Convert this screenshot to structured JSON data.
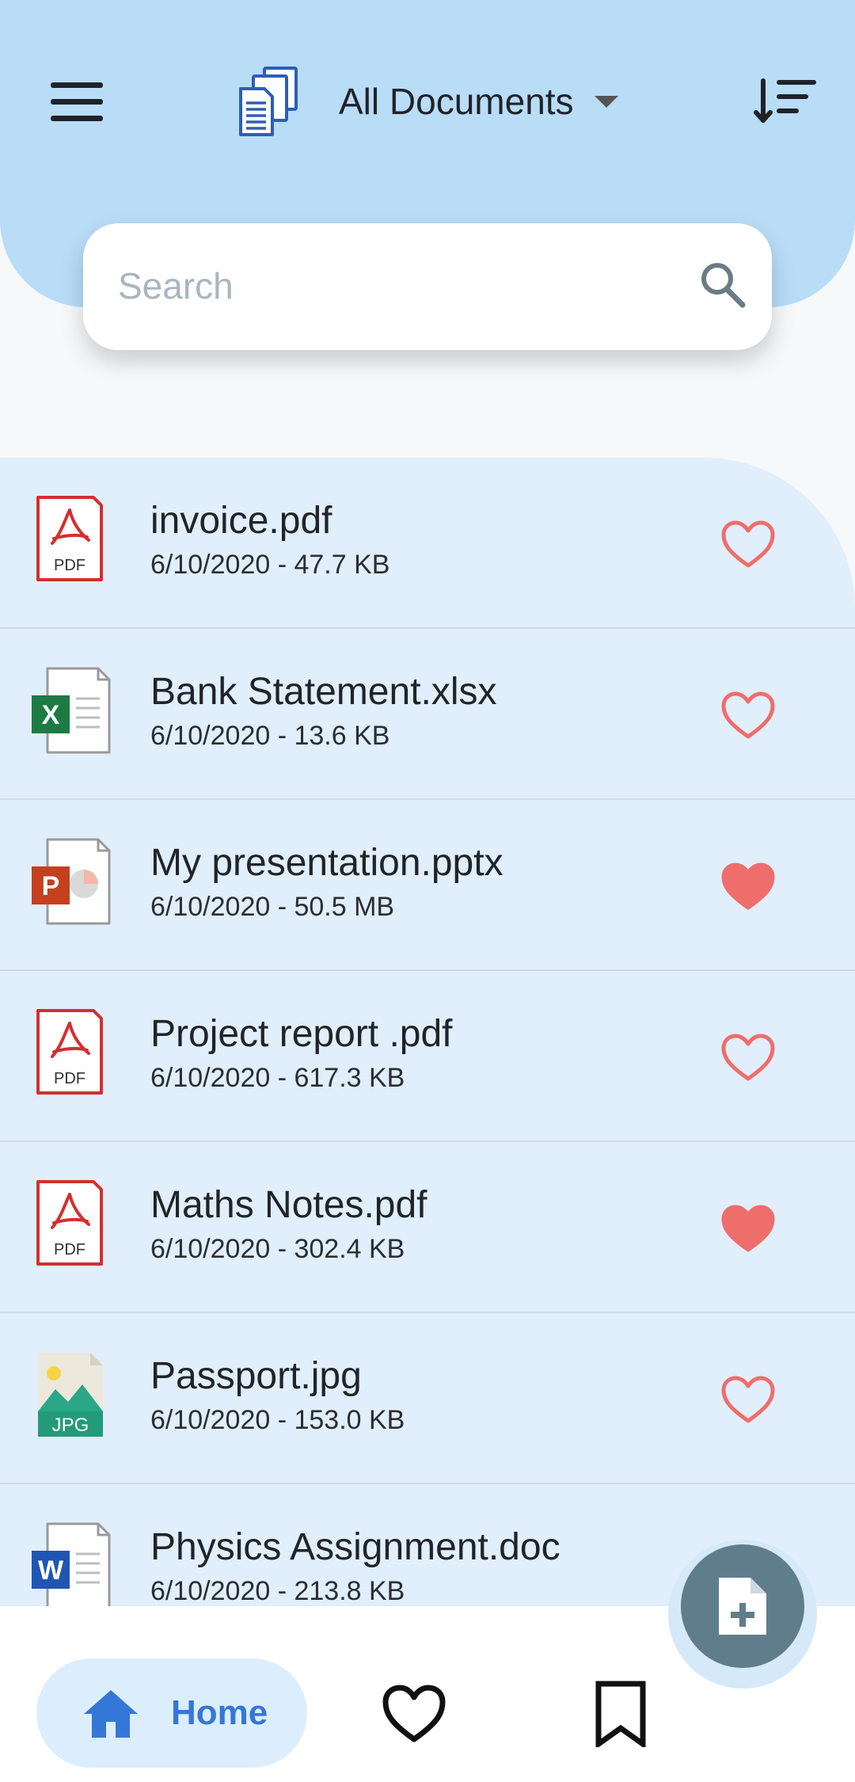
{
  "header": {
    "title": "All Documents",
    "menu_icon": "menu-icon",
    "logo_icon": "documents-stack-icon",
    "sort_icon": "sort-icon",
    "colors": {
      "header_bg": "#b9dcf7",
      "logo_blue": "#2d5fb5"
    }
  },
  "search": {
    "placeholder": "Search",
    "value": "",
    "icon": "search-icon"
  },
  "files": [
    {
      "name": "invoice.pdf",
      "meta": "6/10/2020 - 47.7 KB",
      "type": "pdf",
      "type_label": "PDF",
      "favorite": false
    },
    {
      "name": "Bank Statement.xlsx",
      "meta": "6/10/2020 - 13.6 KB",
      "type": "xlsx",
      "type_label": "X",
      "favorite": false
    },
    {
      "name": "My presentation.pptx",
      "meta": "6/10/2020 - 50.5 MB",
      "type": "pptx",
      "type_label": "P",
      "favorite": true
    },
    {
      "name": "Project report .pdf",
      "meta": "6/10/2020 - 617.3 KB",
      "type": "pdf",
      "type_label": "PDF",
      "favorite": false
    },
    {
      "name": "Maths Notes.pdf",
      "meta": "6/10/2020 - 302.4 KB",
      "type": "pdf",
      "type_label": "PDF",
      "favorite": true
    },
    {
      "name": "Passport.jpg",
      "meta": "6/10/2020 - 153.0 KB",
      "type": "jpg",
      "type_label": "JPG",
      "favorite": false
    },
    {
      "name": "Physics Assignment.doc",
      "meta": "6/10/2020 - 213.8 KB",
      "type": "doc",
      "type_label": "W",
      "favorite": false
    }
  ],
  "fab": {
    "icon": "add-document-icon",
    "color": "#607d8b"
  },
  "bottom_nav": {
    "home_label": "Home",
    "home_icon": "home-icon",
    "favorites_icon": "heart-outline-icon",
    "bookmarks_icon": "bookmark-outline-icon",
    "active_color": "#3577d6"
  },
  "colors": {
    "favorite_red": "#ee6e6c",
    "pdf_red": "#d32f2f",
    "excel_green": "#1d7a43",
    "ppt_orange": "#c4401e",
    "word_blue": "#1f56b3",
    "list_bg": "#e1eefb"
  }
}
